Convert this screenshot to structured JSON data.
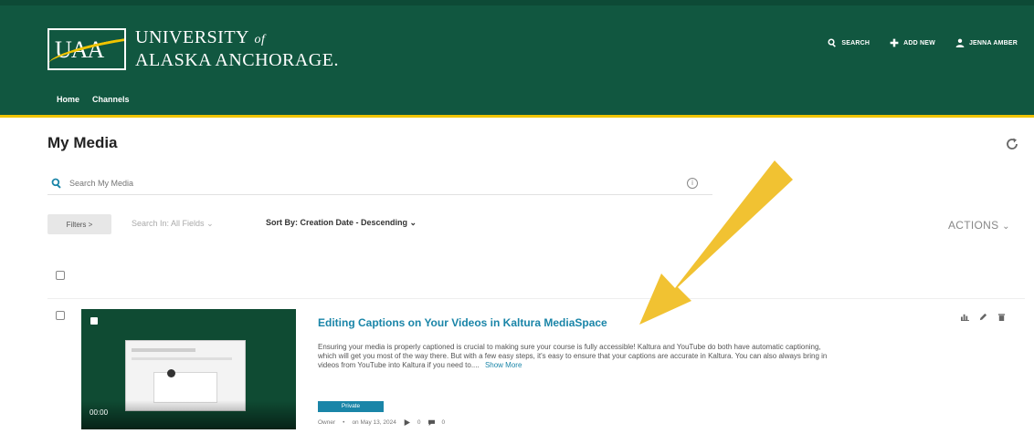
{
  "header": {
    "logo_mark": "UAA",
    "logo_line1": "University",
    "logo_of": "of",
    "logo_line2": "Alaska Anchorage.",
    "nav": [
      "Home",
      "Channels"
    ],
    "actions": {
      "search": "SEARCH",
      "add_new": "ADD NEW",
      "user": "JENNA AMBER"
    }
  },
  "page": {
    "title": "My Media",
    "search_placeholder": "Search My Media",
    "filters_label": "Filters >",
    "search_in": "Search In: All Fields",
    "sort_by": "Sort By: Creation Date - Descending",
    "actions_label": "ACTIONS"
  },
  "media": {
    "title": "Editing Captions on Your Videos in Kaltura MediaSpace",
    "description": "Ensuring your media is properly captioned is crucial to making sure your course is fully accessible! Kaltura and YouTube do both have automatic captioning, which will get you most of the way there. But with a few easy steps, it's easy to ensure that your captions are accurate in Kaltura. You can also always bring in videos from YouTube into Kaltura if you need to....",
    "show_more": "Show More",
    "duration": "00:00",
    "badge": "Private",
    "owner": "Owner",
    "date": "on May 13, 2024",
    "plays": "0",
    "comments": "0"
  },
  "colors": {
    "header_green": "#115740",
    "accent_gold": "#f0c400",
    "link_blue": "#1a85a8",
    "arrow_yellow": "#f1c232"
  }
}
